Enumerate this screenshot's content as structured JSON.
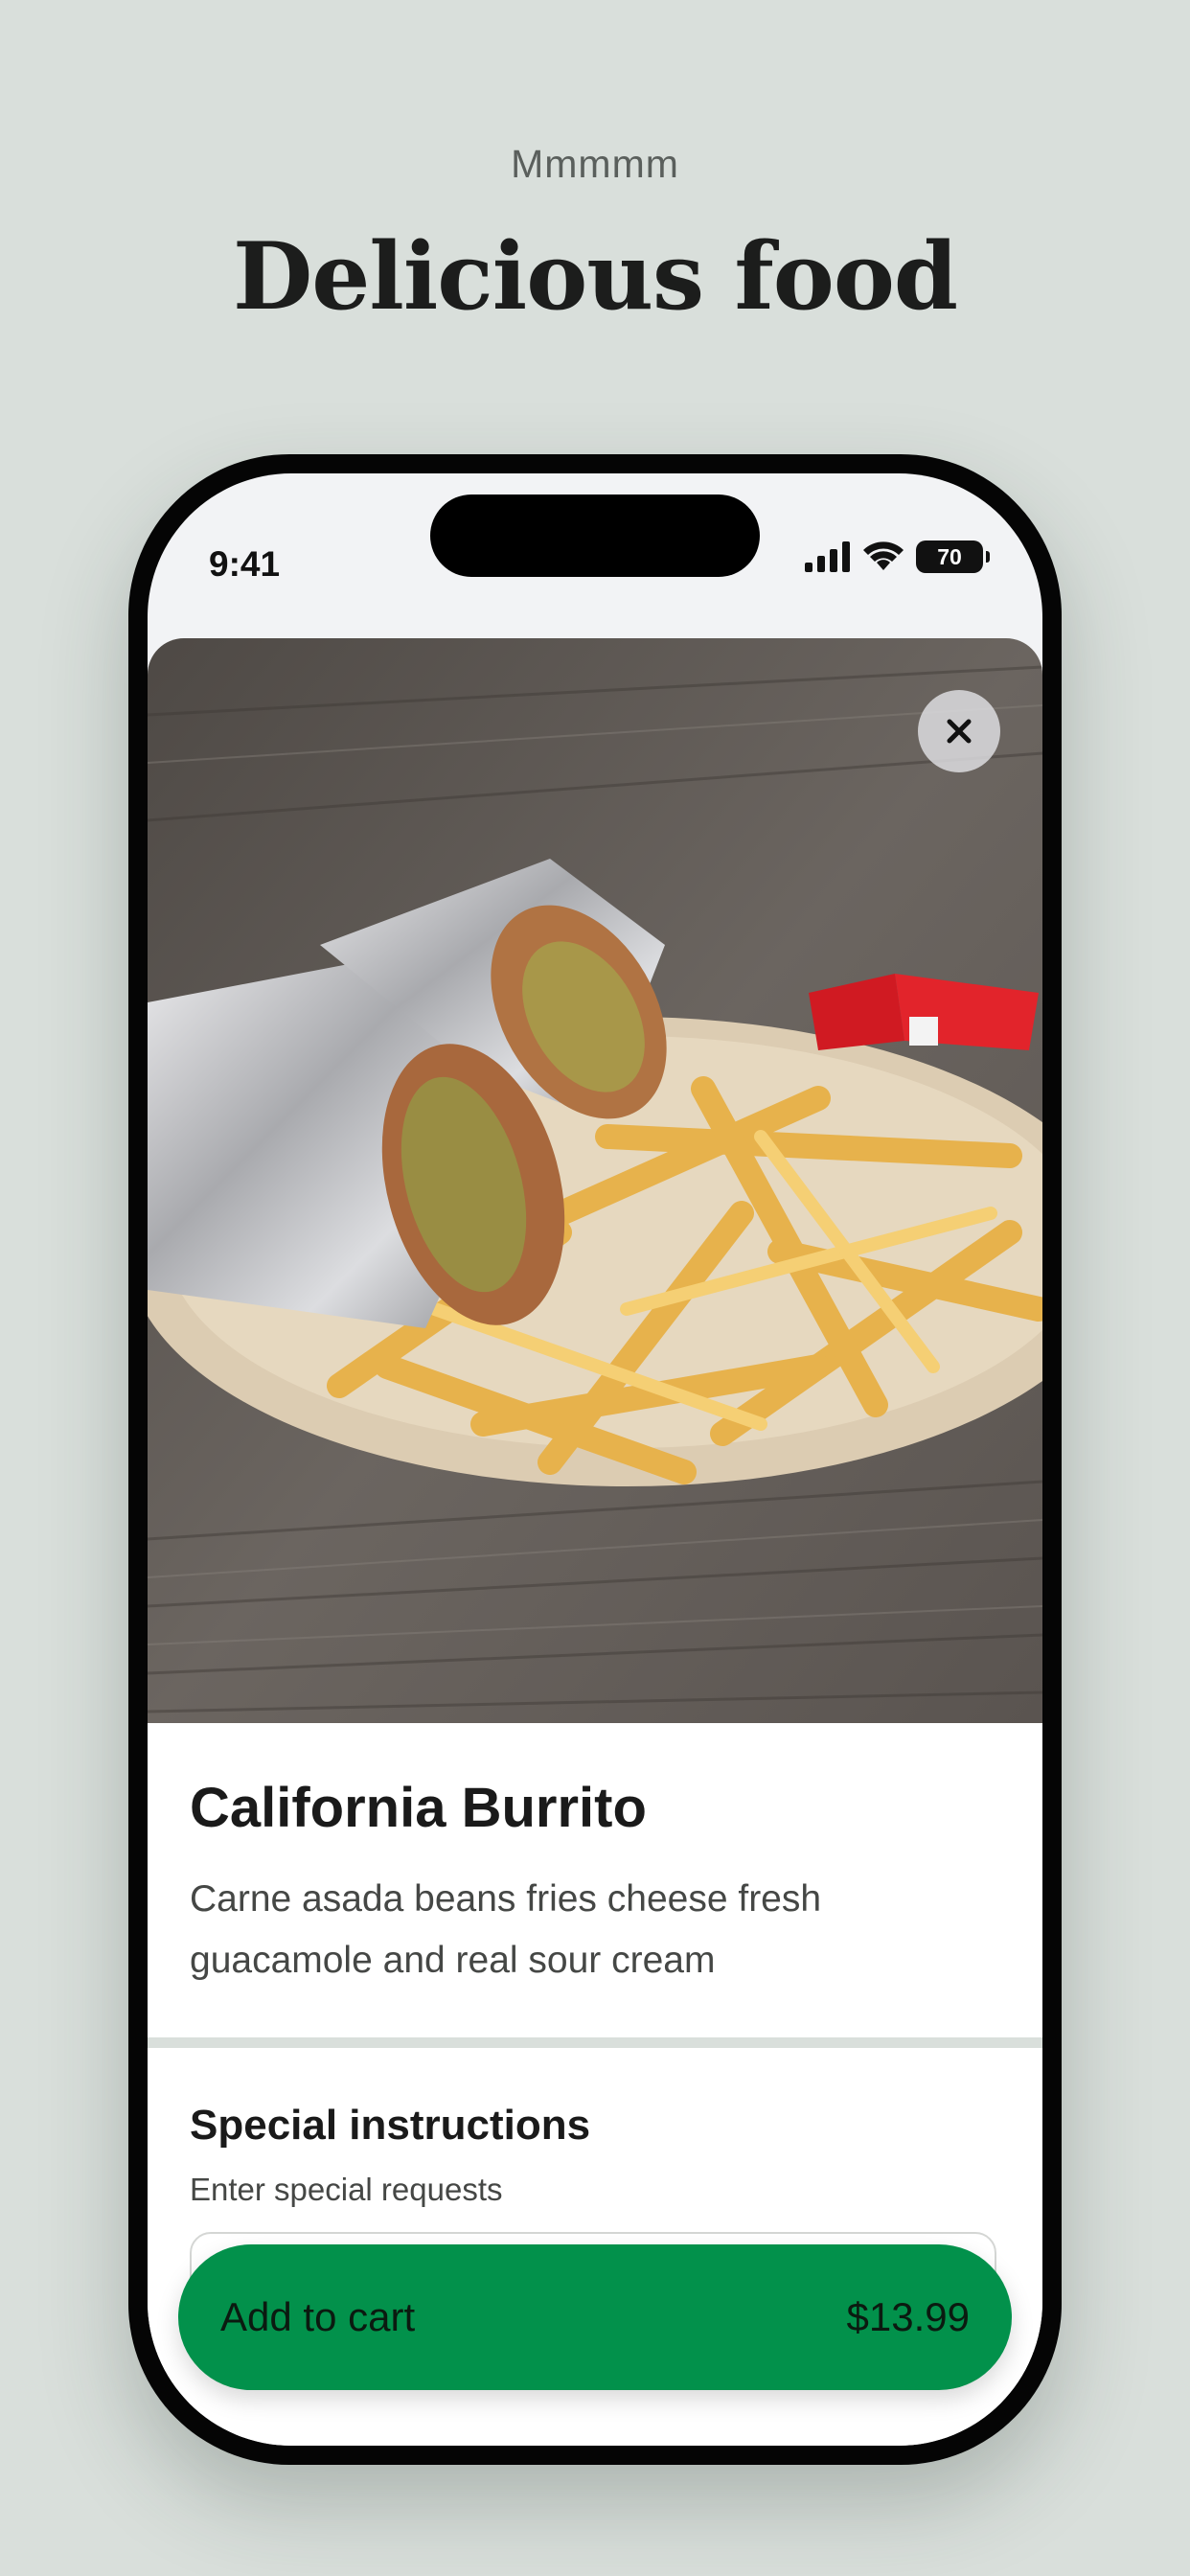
{
  "header": {
    "eyebrow": "Mmmmm",
    "headline": "Delicious food"
  },
  "status_bar": {
    "time": "9:41",
    "battery": "70",
    "icons": [
      "signal-icon",
      "wifi-icon",
      "battery-icon"
    ]
  },
  "item": {
    "image_alt": "California Burrito with fries",
    "title": "California Burrito",
    "description": "Carne asada beans fries cheese fresh guacamole and real sour cream"
  },
  "special_instructions": {
    "title": "Special instructions",
    "subtitle": "Enter special requests",
    "value": ""
  },
  "cart": {
    "label": "Add to cart",
    "price": "$13.99"
  },
  "colors": {
    "background": "#d9dfdb",
    "accent_green": "#02914b",
    "text_dark": "#1a1a1a"
  }
}
